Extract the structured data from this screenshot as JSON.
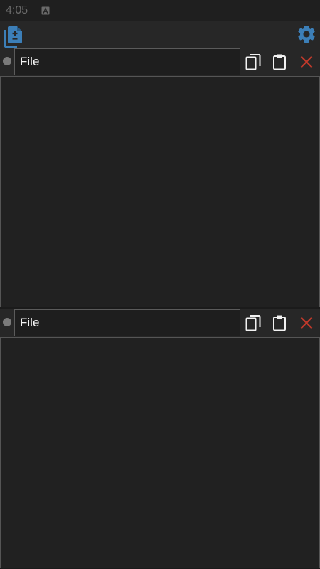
{
  "status_bar": {
    "time": "4:05",
    "notification_icon": "notification-a-icon"
  },
  "toolbar": {
    "left_icon": "document-diff-icon",
    "right_icon": "gear-icon",
    "accent_color": "#3c7fb8"
  },
  "panes": [
    {
      "file_name": "File",
      "copy_icon": "copy-icon",
      "paste_icon": "clipboard-icon",
      "close_icon": "close-icon"
    },
    {
      "file_name": "File",
      "copy_icon": "copy-icon",
      "paste_icon": "clipboard-icon",
      "close_icon": "close-icon"
    }
  ],
  "colors": {
    "close": "#c0392b",
    "indicator": "#7a7a7a"
  }
}
